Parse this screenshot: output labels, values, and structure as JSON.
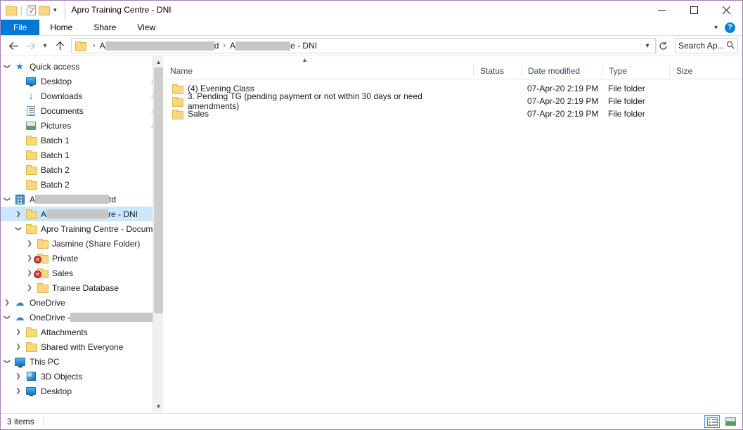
{
  "window": {
    "title": "Apro Training Centre - DNI",
    "controls": {
      "minimize": "Minimize",
      "maximize": "Maximize",
      "close": "Close"
    }
  },
  "quick_access_toolbar": {
    "items": [
      "folder-icon",
      "properties-icon",
      "new-folder-icon",
      "customize-caret"
    ]
  },
  "ribbon": {
    "tabs": [
      {
        "label": "File",
        "active": true
      },
      {
        "label": "Home",
        "active": false
      },
      {
        "label": "Share",
        "active": false
      },
      {
        "label": "View",
        "active": false
      }
    ],
    "collapse_label": "Minimize the Ribbon",
    "help_label": "?"
  },
  "address_bar": {
    "back": "Back",
    "forward": "Forward",
    "recent": "Recent locations",
    "up": "Up",
    "crumbs": [
      {
        "prefix": "A",
        "redacted": true,
        "redact_width": 155,
        "suffix": "d"
      },
      {
        "prefix": "A",
        "redacted": true,
        "redact_width": 78,
        "suffix": "e - DNI"
      }
    ],
    "separator": "›",
    "dropdown": "∨",
    "refresh": "↻"
  },
  "search": {
    "value": "Search Ap...",
    "placeholder": "Search Apro Training Centre - DNI",
    "icon": "search-icon"
  },
  "navigation_pane": {
    "items": [
      {
        "label": "Quick access",
        "icon": "star-icon",
        "indent": 0,
        "expander": "down",
        "pinned": false
      },
      {
        "label": "Desktop",
        "icon": "desktop-icon",
        "indent": 1,
        "expander": "none",
        "pinned": true
      },
      {
        "label": "Downloads",
        "icon": "downloads-icon",
        "indent": 1,
        "expander": "none",
        "pinned": true
      },
      {
        "label": "Documents",
        "icon": "documents-icon",
        "indent": 1,
        "expander": "none",
        "pinned": true
      },
      {
        "label": "Pictures",
        "icon": "pictures-icon",
        "indent": 1,
        "expander": "none",
        "pinned": true
      },
      {
        "label": "Batch 1",
        "icon": "folder-icon",
        "indent": 1,
        "expander": "none",
        "pinned": false
      },
      {
        "label": "Batch 1",
        "icon": "folder-icon",
        "indent": 1,
        "expander": "none",
        "pinned": false
      },
      {
        "label": "Batch 2",
        "icon": "folder-icon",
        "indent": 1,
        "expander": "none",
        "pinned": false
      },
      {
        "label": "Batch 2",
        "icon": "folder-icon",
        "indent": 1,
        "expander": "none",
        "pinned": false
      },
      {
        "label": "A",
        "suffix": "td",
        "redacted": true,
        "redact_width": 105,
        "icon": "sharepoint-icon",
        "indent": 0,
        "expander": "down",
        "pinned": false
      },
      {
        "label": "A",
        "suffix": "re - DNI",
        "redacted": true,
        "redact_width": 88,
        "icon": "folder-icon",
        "indent": 1,
        "expander": "right",
        "pinned": false,
        "selected": true
      },
      {
        "label": "Apro Training Centre - Documents",
        "icon": "folder-icon",
        "indent": 1,
        "expander": "down",
        "pinned": false
      },
      {
        "label": "Jasmine (Share Folder)",
        "icon": "folder-icon",
        "indent": 2,
        "expander": "right",
        "pinned": false
      },
      {
        "label": "Private",
        "icon": "folder-icon",
        "indent": 2,
        "expander": "right",
        "pinned": false,
        "error": true
      },
      {
        "label": "Sales",
        "icon": "folder-icon",
        "indent": 2,
        "expander": "right",
        "pinned": false,
        "error": true
      },
      {
        "label": "Trainee Database",
        "icon": "folder-icon",
        "indent": 2,
        "expander": "right",
        "pinned": false
      },
      {
        "label": "OneDrive",
        "icon": "onedrive-icon",
        "indent": 0,
        "expander": "right",
        "pinned": false
      },
      {
        "label": "OneDrive - ",
        "redacted": true,
        "redact_width": 135,
        "icon": "onedrive-icon",
        "indent": 0,
        "expander": "down",
        "pinned": false
      },
      {
        "label": "Attachments",
        "icon": "folder-icon",
        "indent": 1,
        "expander": "right",
        "pinned": false
      },
      {
        "label": "Shared with Everyone",
        "icon": "folder-icon",
        "indent": 1,
        "expander": "right",
        "pinned": false
      },
      {
        "label": "This PC",
        "icon": "this-pc-icon",
        "indent": 0,
        "expander": "down",
        "pinned": false
      },
      {
        "label": "3D Objects",
        "icon": "3d-objects-icon",
        "indent": 1,
        "expander": "right",
        "pinned": false
      },
      {
        "label": "Desktop",
        "icon": "desktop-icon",
        "indent": 1,
        "expander": "right",
        "pinned": false
      }
    ]
  },
  "file_list": {
    "sort_indicator": "ascending",
    "columns": [
      {
        "key": "name",
        "label": "Name"
      },
      {
        "key": "status",
        "label": "Status"
      },
      {
        "key": "date",
        "label": "Date modified"
      },
      {
        "key": "type",
        "label": "Type"
      },
      {
        "key": "size",
        "label": "Size"
      }
    ],
    "rows": [
      {
        "name": "(4) Evening Class",
        "status": "",
        "date": "07-Apr-20 2:19 PM",
        "type": "File folder",
        "size": "",
        "icon": "folder-icon"
      },
      {
        "name": "3. Pending TG (pending payment or not within 30 days or need amendments)",
        "status": "",
        "date": "07-Apr-20 2:19 PM",
        "type": "File folder",
        "size": "",
        "icon": "folder-icon"
      },
      {
        "name": "Sales",
        "status": "",
        "date": "07-Apr-20 2:19 PM",
        "type": "File folder",
        "size": "",
        "icon": "folder-icon"
      }
    ]
  },
  "status_bar": {
    "item_count": "3 items",
    "views": [
      {
        "name": "details-view",
        "active": true
      },
      {
        "name": "large-icons-view",
        "active": false
      }
    ]
  }
}
